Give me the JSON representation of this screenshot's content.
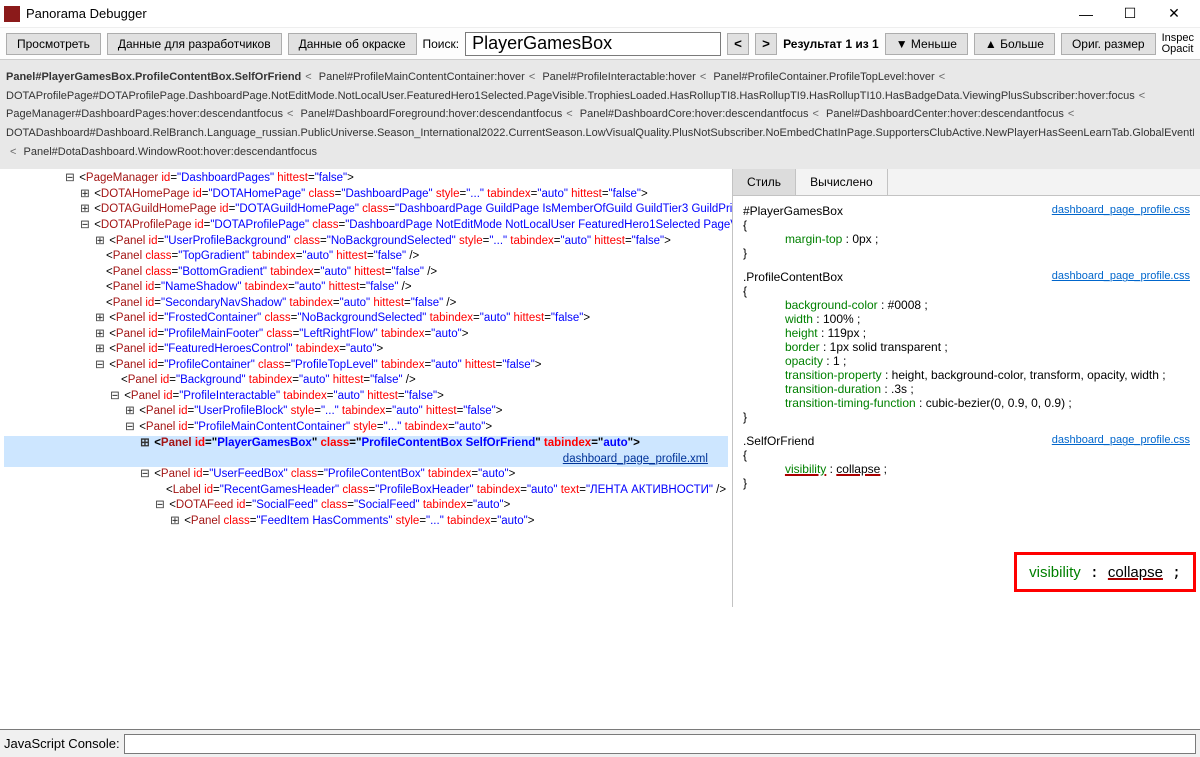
{
  "window": {
    "title": "Panorama Debugger"
  },
  "toolbar": {
    "view": "Просмотреть",
    "devdata": "Данные для разработчиков",
    "colordata": "Данные об окраске",
    "search_label": "Поиск:",
    "search_value": "PlayerGamesBox",
    "result_text": "Результат 1 из 1",
    "less": "▼ Меньше",
    "more": "▲ Больше",
    "orig": "Ориг. размер",
    "inspect1": "Inspec",
    "inspect2": "Opacit"
  },
  "breadcrumbs": {
    "line1_a": "Panel#PlayerGamesBox.ProfileContentBox.SelfOrFriend",
    "line1_b": "Panel#ProfileMainContentContainer:hover",
    "line1_c": "Panel#ProfileInteractable:hover",
    "line1_d": "Panel#ProfileContainer.ProfileTopLevel:hover",
    "line2": "DOTAProfilePage#DOTAProfilePage.DashboardPage.NotEditMode.NotLocalUser.FeaturedHero1Selected.PageVisible.TrophiesLoaded.HasRollupTI8.HasRollupTI9.HasRollupTI10.HasBadgeData.ViewingPlusSubscriber:hover:focus",
    "line3_a": "PageManager#DashboardPages:hover:descendantfocus",
    "line3_b": "Panel#DashboardForeground:hover:descendantfocus",
    "line3_c": "Panel#DashboardCore:hover:descendantfocus",
    "line3_d": "Panel#DashboardCenter:hover:descendantfocus",
    "line4": "DOTADashboard#Dashboard.RelBranch.Language_russian.PublicUniverse.Season_International2022.CurrentSeason.LowVisualQuality.PlusNotSubscriber.NoEmbedChatInPage.SupportersClubActive.NewPlayerHasSeenLearnTab.GlobalEventEnded.HideIntroLogo.As…",
    "line5": "Panel#DotaDashboard.WindowRoot:hover:descendantfocus"
  },
  "tree": {
    "selected_xml": "dashboard_page_profile.xml",
    "selected_tag": "Panel",
    "selected_id": "PlayerGamesBox",
    "selected_class": "ProfileContentBox SelfOrFriend",
    "selected_tab": "auto"
  },
  "styles": {
    "tab_style": "Стиль",
    "tab_computed": "Вычислено",
    "srclink": "dashboard_page_profile.css",
    "rules": [
      {
        "selector": "#PlayerGamesBox",
        "decls": [
          {
            "prop": "margin-top",
            "val": "0px"
          }
        ]
      },
      {
        "selector": ".ProfileContentBox",
        "decls": [
          {
            "prop": "background-color",
            "val": "#0008"
          },
          {
            "prop": "width",
            "val": "100%"
          },
          {
            "prop": "height",
            "val": "119px"
          },
          {
            "prop": "border",
            "val": "1px solid transparent"
          },
          {
            "prop": "opacity",
            "val": "1"
          },
          {
            "prop": "transition-property",
            "val": "height, background-color, transform, opacity, width"
          },
          {
            "prop": "transition-duration",
            "val": ".3s"
          },
          {
            "prop": "transition-timing-function",
            "val": "cubic-bezier(0, 0.9, 0, 0.9)"
          }
        ]
      },
      {
        "selector": ".SelfOrFriend",
        "decls": [
          {
            "prop": "visibility",
            "val": "collapse",
            "strike": true
          }
        ]
      }
    ],
    "callout": {
      "prop": "visibility",
      "val": "collapse"
    }
  },
  "console": {
    "label": "JavaScript Console:",
    "value": ""
  }
}
